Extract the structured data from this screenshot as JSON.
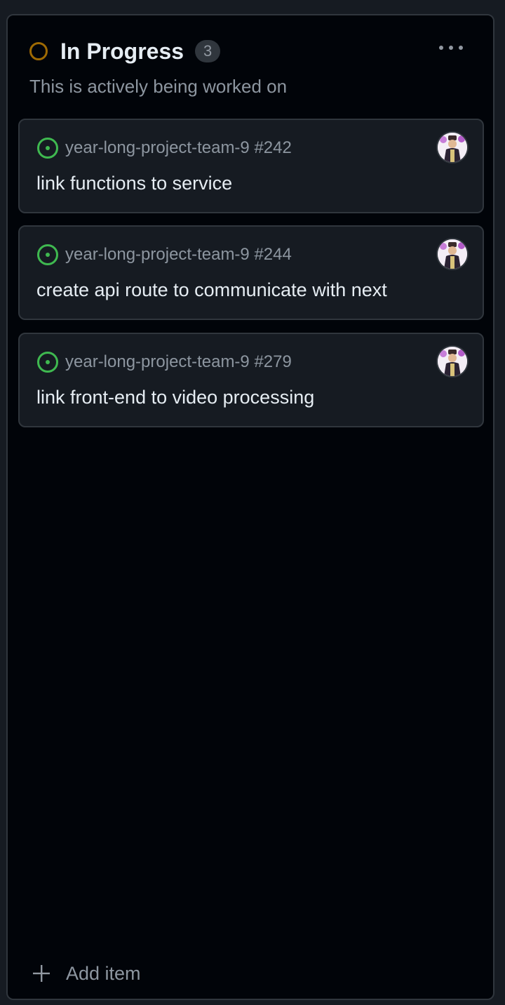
{
  "column": {
    "title": "In Progress",
    "count": "3",
    "description": "This is actively being worked on",
    "status_color": "#9e6a03",
    "menu_icon": "kebab-horizontal-icon"
  },
  "cards": [
    {
      "repo": "year-long-project-team-9 #242",
      "title": "link functions to service",
      "status_icon": "issue-opened-icon",
      "status_color": "#3fb950",
      "avatar": "assignee-avatar"
    },
    {
      "repo": "year-long-project-team-9 #244",
      "title": "create api route to communicate with next",
      "status_icon": "issue-opened-icon",
      "status_color": "#3fb950",
      "avatar": "assignee-avatar"
    },
    {
      "repo": "year-long-project-team-9 #279",
      "title": "link front-end to video processing",
      "status_icon": "issue-opened-icon",
      "status_color": "#3fb950",
      "avatar": "assignee-avatar"
    }
  ],
  "footer": {
    "add_label": "Add item",
    "add_icon": "plus-icon"
  }
}
